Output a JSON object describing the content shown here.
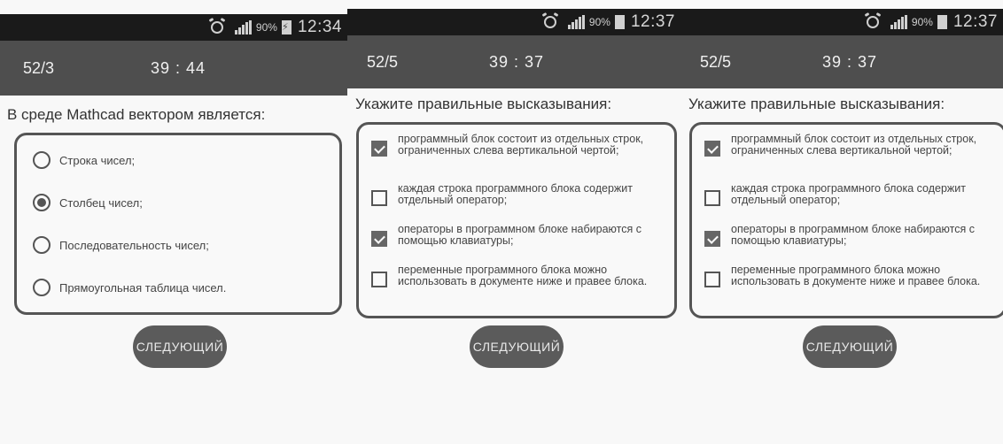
{
  "screens": [
    {
      "status": {
        "battery": "90%",
        "time": "12:34"
      },
      "counter": "52/3",
      "timer": "39 : 44",
      "question": "В среде Mathcad вектором является:",
      "options": [
        {
          "label": "Строка чисел;",
          "selected": false
        },
        {
          "label": "Столбец чисел;",
          "selected": true
        },
        {
          "label": "Последовательность чисел;",
          "selected": false
        },
        {
          "label": "Прямоугольная таблица чисел.",
          "selected": false
        }
      ],
      "next_label": "СЛЕДУЮЩИЙ"
    },
    {
      "status": {
        "battery": "90%",
        "time": "12:37"
      },
      "counter": "52/5",
      "timer": "39 : 37",
      "question": "Укажите правильные высказывания:",
      "options": [
        {
          "label": "программный блок состоит из отдельных строк, ограниченных слева вертикальной чертой;",
          "checked": true
        },
        {
          "label": "каждая строка программного блока содержит отдельный оператор;",
          "checked": false
        },
        {
          "label": "операторы в программном блоке набираются с помощью клавиатуры;",
          "checked": true
        },
        {
          "label": "переменные программного блока можно использовать в документе ниже и правее блока.",
          "checked": false
        }
      ],
      "next_label": "СЛЕДУЮЩИЙ"
    },
    {
      "status": {
        "battery": "90%",
        "time": "12:37"
      },
      "counter": "52/5",
      "timer": "39 : 37",
      "question": "Укажите правильные высказывания:",
      "options": [
        {
          "label": "программный блок состоит из отдельных строк, ограниченных слева вертикальной чертой;",
          "checked": true
        },
        {
          "label": "каждая строка программного блока содержит отдельный оператор;",
          "checked": false
        },
        {
          "label": "операторы в программном блоке набираются с помощью клавиатуры;",
          "checked": true
        },
        {
          "label": "переменные программного блока можно использовать в документе ниже и правее блока.",
          "checked": false
        }
      ],
      "next_label": "СЛЕДУЮЩИЙ"
    }
  ]
}
